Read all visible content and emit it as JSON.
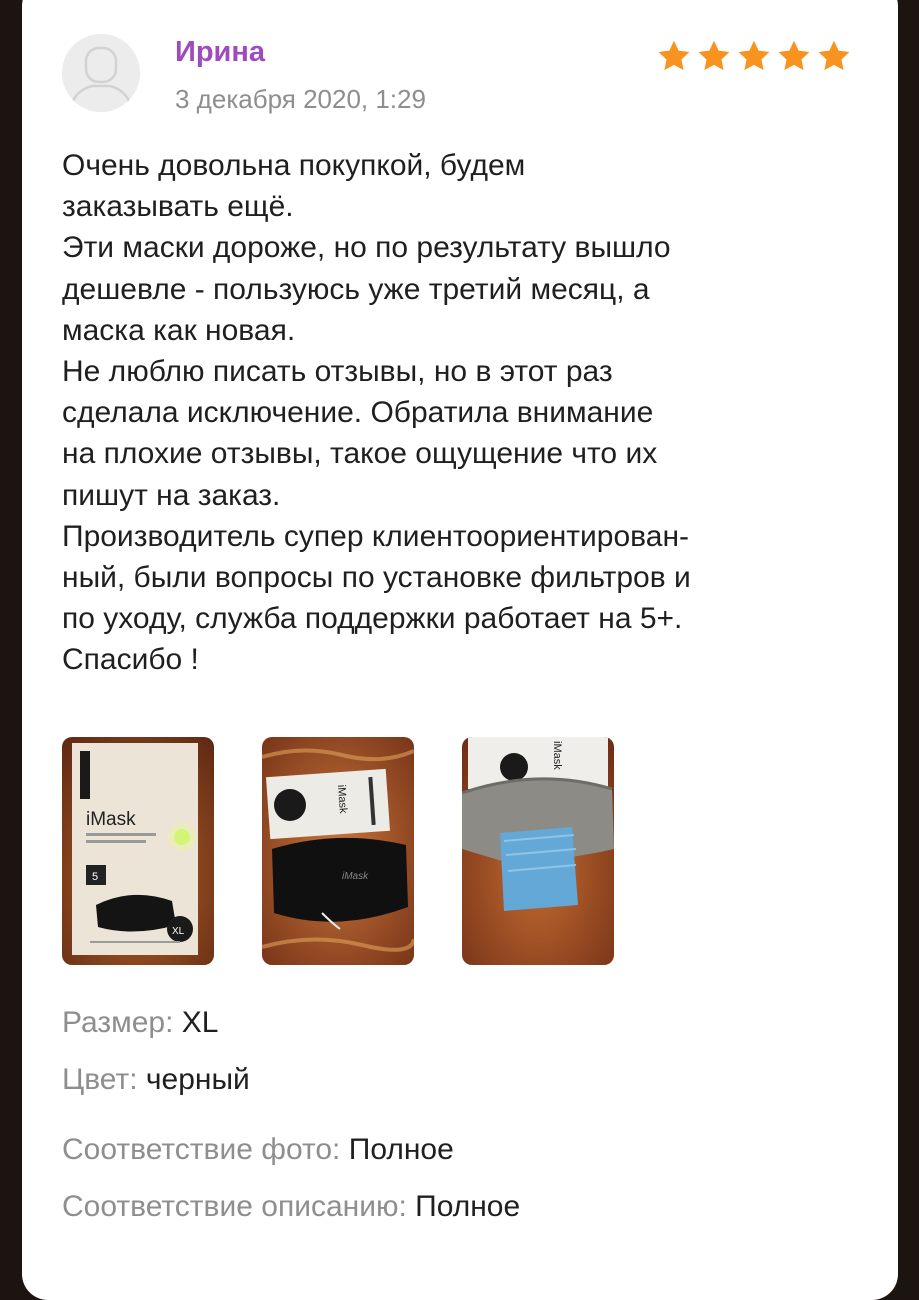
{
  "review": {
    "author": "Ирина",
    "date": "3 декабря 2020, 1:29",
    "rating": 5,
    "star_color": "#f7931e",
    "author_color": "#a04bbd",
    "paragraphs": [
      "Очень довольна покупкой, будем\nзаказывать ещё.",
      "Эти маски дороже, но по результату вышло\nдешевле - пользуюсь уже третий месяц, а\nмаска как новая.",
      "Не люблю писать отзывы, но в этот раз\nсделала исключение. Обратила внимание\nна плохие отзывы, такое ощущение что их\nпишут на заказ.",
      "Производитель супер клиентоориентирован-\nный, были вопросы по установке фильтров и\nпо уходу, служба поддержки работает на 5+.\nСпасибо !"
    ],
    "photos": [
      {
        "brand": "iMask",
        "size_badge": "XL",
        "count": "5"
      },
      {
        "brand": "iMask",
        "side_label": "iMask"
      },
      {
        "side_label": "iMask"
      }
    ],
    "attributes": [
      {
        "label": "Размер:",
        "value": "XL"
      },
      {
        "label": "Цвет:",
        "value": "черный"
      },
      {
        "label": "Соответствие фото:",
        "value": "Полное"
      },
      {
        "label": "Соответствие описанию:",
        "value": "Полное"
      }
    ]
  },
  "icons": {
    "avatar": "user-placeholder-icon",
    "star": "star-icon"
  }
}
